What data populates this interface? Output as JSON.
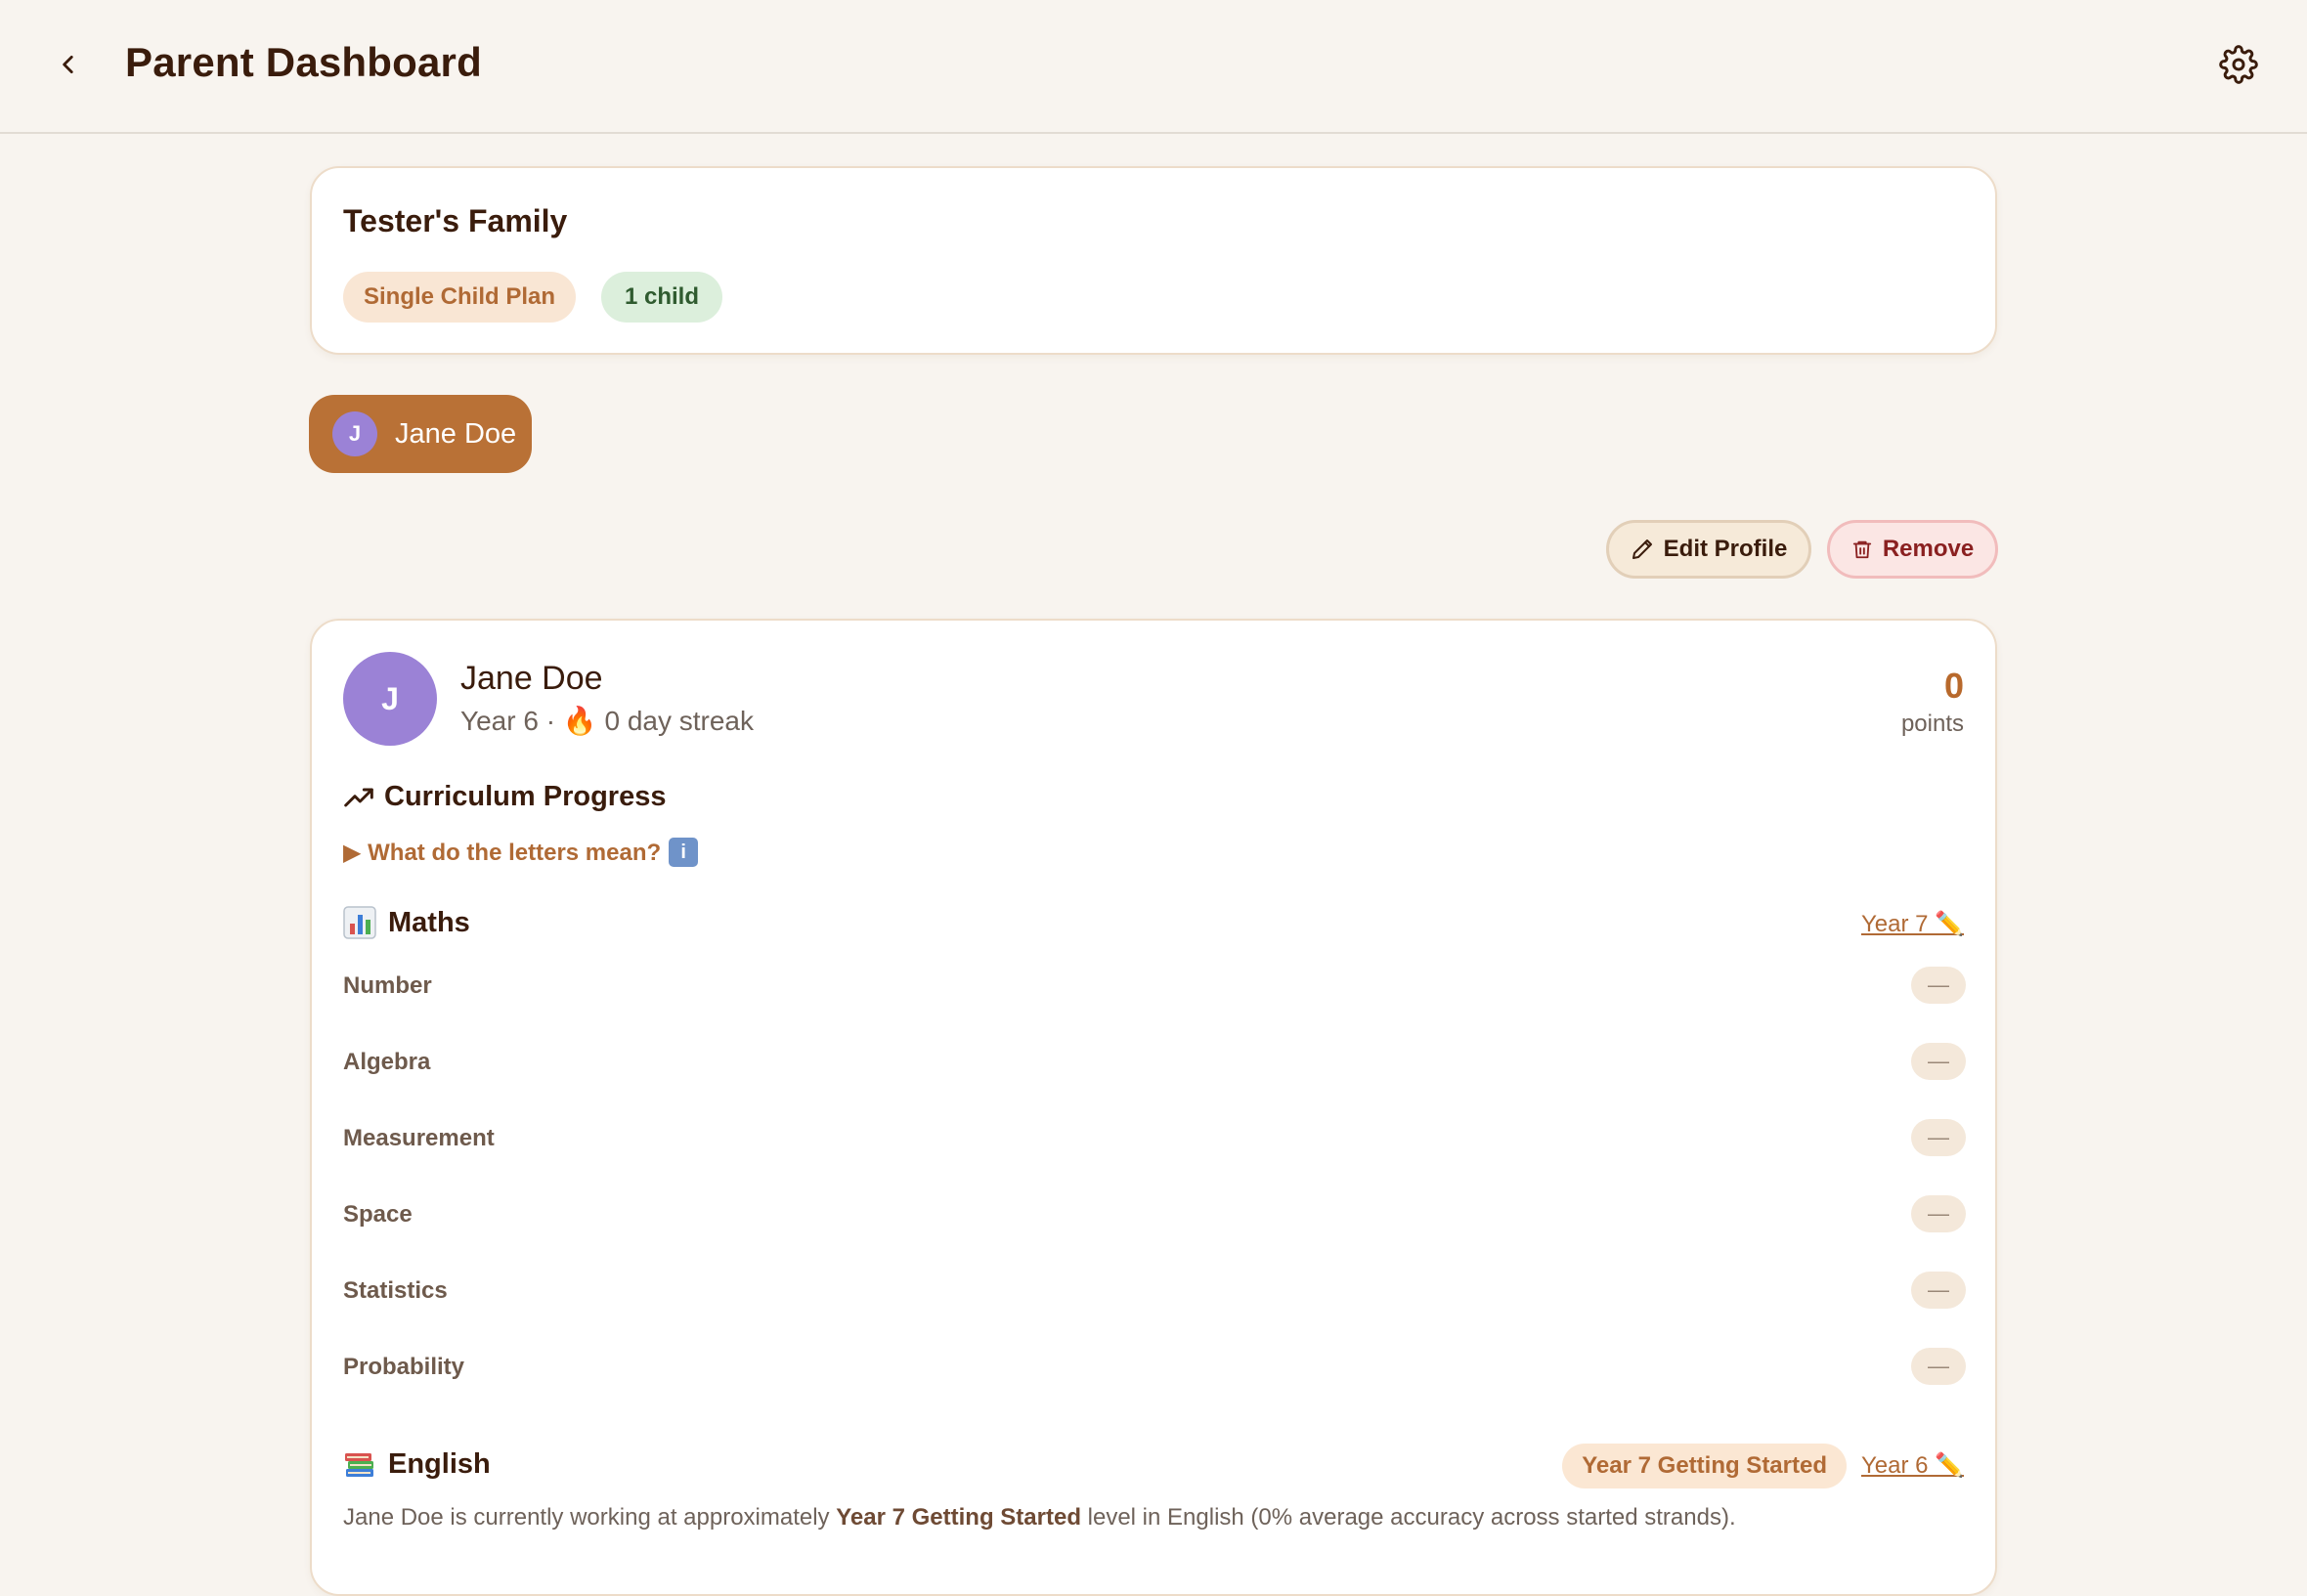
{
  "header": {
    "title": "Parent Dashboard",
    "back_icon": "chevron-left-icon",
    "settings_icon": "gear-icon"
  },
  "family": {
    "name": "Tester's Family",
    "plan": "Single Child Plan",
    "children_count": "1 child"
  },
  "child_tabs": [
    {
      "initial": "J",
      "name": "Jane Doe",
      "selected": true
    }
  ],
  "actions": {
    "edit_label": "Edit Profile",
    "remove_label": "Remove"
  },
  "child": {
    "initial": "J",
    "name": "Jane Doe",
    "year": "Year 6 ·",
    "streak_emoji": "🔥",
    "streak": "0 day streak",
    "points": "0",
    "points_label": "points"
  },
  "curriculum": {
    "title": "Curriculum Progress",
    "letters_link": "▶ What do the letters mean?",
    "info_glyph": "i"
  },
  "maths": {
    "icon": "bar-chart-icon",
    "title": "Maths",
    "year_link": "Year 7 ✏️",
    "strands": [
      {
        "label": "Number",
        "level": "—"
      },
      {
        "label": "Algebra",
        "level": "—"
      },
      {
        "label": "Measurement",
        "level": "—"
      },
      {
        "label": "Space",
        "level": "—"
      },
      {
        "label": "Statistics",
        "level": "—"
      },
      {
        "label": "Probability",
        "level": "—"
      }
    ]
  },
  "english": {
    "icon": "books-icon",
    "title": "English",
    "level_badge": "Year 7 Getting Started",
    "year_link": "Year 6 ✏️",
    "summary_prefix": "Jane Doe is currently working at approximately ",
    "summary_level": "Year 7 Getting Started",
    "summary_suffix": " level in English (0% average accuracy across started strands)."
  },
  "colors": {
    "background": "#f8f4ef",
    "accent": "#b97136",
    "avatar": "#9b82d6",
    "text_dark": "#3a1c0c"
  }
}
